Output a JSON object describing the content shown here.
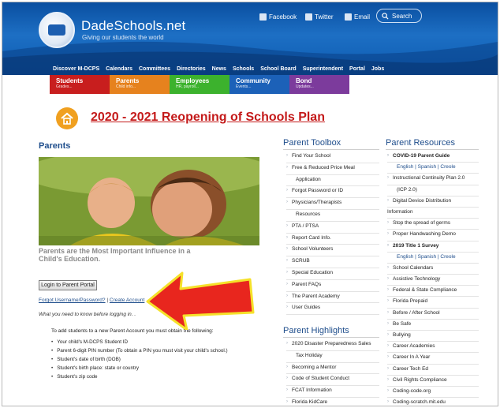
{
  "header": {
    "site_name": "DadeSchools.net",
    "tagline": "Giving our students the world",
    "social": {
      "facebook": "Facebook",
      "twitter": "Twitter",
      "email": "Email"
    },
    "search_label": "Search",
    "nav": [
      "Discover M-DCPS",
      "Calendars",
      "Committees",
      "Directories",
      "News",
      "Schools",
      "School Board",
      "Superintendent",
      "Portal",
      "Jobs"
    ]
  },
  "tabs": [
    {
      "title": "Students",
      "sub": "Grades..."
    },
    {
      "title": "Parents",
      "sub": "Child info..."
    },
    {
      "title": "Employees",
      "sub": "HR, payroll..."
    },
    {
      "title": "Community",
      "sub": "Events..."
    },
    {
      "title": "Bond",
      "sub": "Updates..."
    }
  ],
  "main": {
    "reopening_link": "2020 - 2021 Reopening of Schools Plan",
    "section_title": "Parents",
    "caption": "Parents are the Most Important Influence in a Child's Education.",
    "login_button": "Login to Parent Portal",
    "forgot_link": "Forgot Username/Password?",
    "separator": "|",
    "create_link": "Create Account",
    "need_to_know": "What you need to know before logging in. .",
    "add_students": "To add students to a new Parent Account you must obtain the following:",
    "requirements": [
      "Your child's M-DCPS Student ID",
      "Parent 6-digit PIN number (To obtain a PIN you must visit your child's school.)",
      "Student's date of birth (DOB)",
      "Student's birth place: state or country",
      "Student's zip code"
    ]
  },
  "toolbox": {
    "title": "Parent Toolbox",
    "items": [
      {
        "text": "Find Your School",
        "bullet": true
      },
      {
        "text": "Free & Reduced Price Meal",
        "bullet": true
      },
      {
        "text": "Application",
        "bullet": false
      },
      {
        "text": "Forgot Password or ID",
        "bullet": true
      },
      {
        "text": "Physicians/Therapists",
        "bullet": true
      },
      {
        "text": "Resources",
        "bullet": false
      },
      {
        "text": "PTA / PTSA",
        "bullet": true
      },
      {
        "text": "Report Card Info.",
        "bullet": true
      },
      {
        "text": "School Volunteers",
        "bullet": true
      },
      {
        "text": "SCRUB",
        "bullet": true
      },
      {
        "text": "Special Education",
        "bullet": true
      },
      {
        "text": "Parent FAQs",
        "bullet": true
      },
      {
        "text": "The Parent Academy",
        "bullet": true
      },
      {
        "text": "User Guides",
        "bullet": true
      }
    ]
  },
  "highlights": {
    "title": "Parent Highlights",
    "items": [
      {
        "text": "2020 Disaster Preparedness Sales",
        "bullet": true
      },
      {
        "text": "Tax Holiday",
        "bullet": false
      },
      {
        "text": "Becoming a Mentor",
        "bullet": true
      },
      {
        "text": "Code of Student Conduct",
        "bullet": true
      },
      {
        "text": "FCAT Information",
        "bullet": true
      },
      {
        "text": "Florida KidCare",
        "bullet": true
      }
    ]
  },
  "resources": {
    "title": "Parent Resources",
    "items": [
      {
        "text": "COVID-19 Parent Guide",
        "kind": "bold"
      },
      {
        "text": "English | Spanish | Creole",
        "kind": "link"
      },
      {
        "text": "Instructional Continuity Plan 2.0",
        "kind": "bullet"
      },
      {
        "text": "(ICP 2.0)",
        "kind": "cont"
      },
      {
        "text": "Digital Device Distribution",
        "kind": "bullet"
      },
      {
        "text": "Information",
        "kind": "plain"
      },
      {
        "text": "Stop the spread of germs",
        "kind": "bullet"
      },
      {
        "text": "Proper Handwashing Demo",
        "kind": "bullet"
      },
      {
        "text": "2019 Title 1 Survey",
        "kind": "bold"
      },
      {
        "text": "English | Spanish | Creole",
        "kind": "link"
      },
      {
        "text": "School Calendars",
        "kind": "bullet"
      },
      {
        "text": "Assistive Technology",
        "kind": "bullet"
      },
      {
        "text": "Federal & State Compliance",
        "kind": "bullet"
      },
      {
        "text": "Florida Prepaid",
        "kind": "bullet"
      },
      {
        "text": "Before / After School",
        "kind": "bullet"
      },
      {
        "text": "Be Safe",
        "kind": "bullet"
      },
      {
        "text": "Bullying",
        "kind": "bullet"
      },
      {
        "text": "Career Academies",
        "kind": "bullet"
      },
      {
        "text": "Career In A Year",
        "kind": "bullet"
      },
      {
        "text": "Career Tech Ed",
        "kind": "bullet"
      },
      {
        "text": "Civil Rights Compliance",
        "kind": "bullet"
      },
      {
        "text": "Coding-code.org",
        "kind": "bullet"
      },
      {
        "text": "Coding-scratch.mit.edu",
        "kind": "bullet"
      }
    ]
  },
  "colors": {
    "header_blue": "#1d6fc4",
    "link_red": "#c41a1a",
    "arrow_red": "#e8261e",
    "arrow_outline": "#f5e12a"
  }
}
